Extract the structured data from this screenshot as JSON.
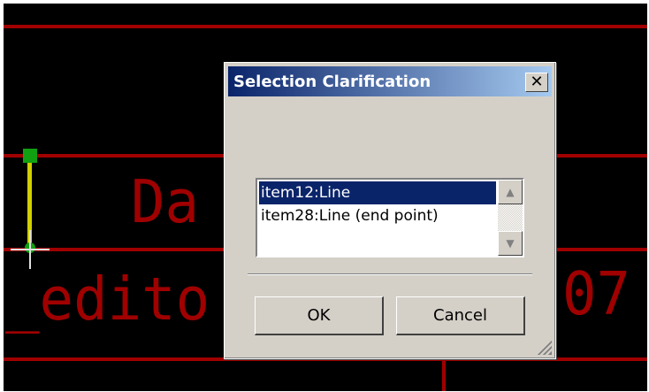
{
  "canvas": {
    "text_line1": "Da",
    "text_line2": "_edito",
    "text_right": "07"
  },
  "dialog": {
    "title": "Selection Clarification",
    "close_label": "✕",
    "items": [
      {
        "label": "item12:Line",
        "selected": true
      },
      {
        "label": "item28:Line (end point)",
        "selected": false
      }
    ],
    "ok_label": "OK",
    "cancel_label": "Cancel"
  },
  "colors": {
    "canvas_bg": "#000000",
    "cad_red": "#a00000",
    "dialog_face": "#d4d0c8",
    "selection": "#0a246a"
  }
}
